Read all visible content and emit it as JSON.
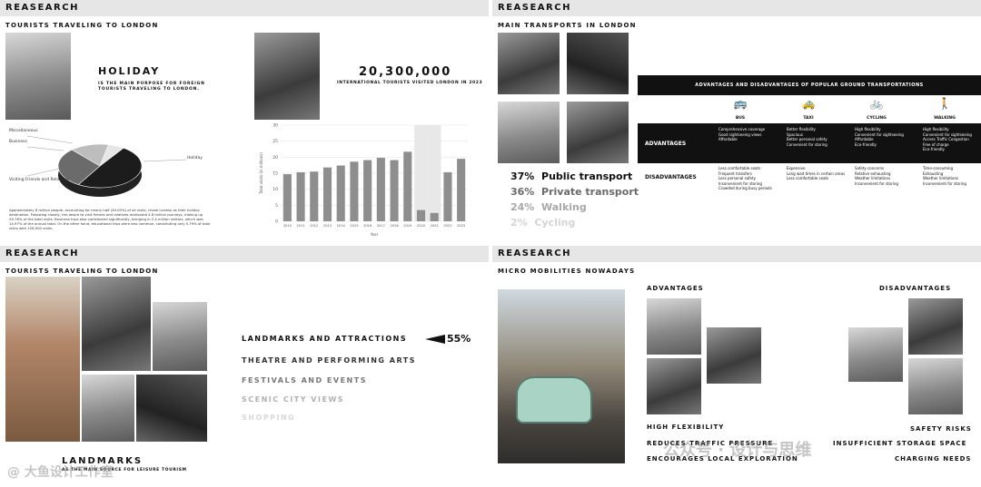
{
  "panels": {
    "p1": {
      "header": "REASEARCH",
      "subtitle": "TOURISTS TRAVELING TO LONDON",
      "holiday_title": "HOLIDAY",
      "holiday_text": "IS THE MAIN PURPOSE FOR FOREIGN TOURISTS TRAVELING TO LONDON.",
      "big_number": "20,300,000",
      "big_number_caption": "INTERNATIONAL TOURISTS VISITED LONDON IN 2023",
      "pie_labels": [
        "Miscellaneous",
        "Business",
        "Visiting Friends and Relatives",
        "Holiday"
      ],
      "paragraph": "Approximately 8 million people, accounting for nearly half (49.05%) of all visits, chose London as their holiday destination. Following closely, the desire to visit friends and relatives motivated 4.8 million journeys, making up 29.76% of the total visits. Business trips also contributed significantly, bringing in 2.4 million visitors, which was 14.97% of the annual total. On the other hand, educational trips were less common, constituting only 0.79% of total visits with 128,000 visits."
    },
    "p2": {
      "header": "REASEARCH",
      "subtitle": "MAIN TRANSPORTS IN LONDON",
      "table_title": "ADVANTAGES AND DISADVANTAGES OF POPULAR GROUND TRANSPORTATIONS",
      "modes": [
        "BUS",
        "TAXI",
        "CYCLING",
        "WALKING"
      ],
      "advantages_label": "ADVANTAGES",
      "disadvantages_label": "DISADVANTAGES",
      "adv": [
        "Comprehensive coverage\nGood sightseeing views\nAffordable",
        "Better flexibility\nSpacious\nBetter personal safety\nConvenient for storing",
        "High flexibility\nConvenient for sightseeing\nAffordable\nEco-friendly",
        "High flexibility\nConvenient for sightseeing\nAccess Traffic Congestion\nFree of charge\nEco-friendly"
      ],
      "dis": [
        "Less comfortable seats\nFrequent transfers\nLess personal safety\nInconvenient for storing\nCrowded during busy periods",
        "Expensive\nLong wait times in certain areas\nLess comfortable seats",
        "Safety concerns\nRelative exhausting\nWeather limitations\nInconvenient for storing",
        "Time-consuming\nExhausting\nWeather limitations\nInconvenient for storing"
      ],
      "shares": [
        {
          "pct": "37%",
          "label": "Public transport",
          "color": "#111111"
        },
        {
          "pct": "36%",
          "label": "Private transport",
          "color": "#6a6a6a"
        },
        {
          "pct": "24%",
          "label": "Walking",
          "color": "#a8a8a8"
        },
        {
          "pct": "2%",
          "label": "Cycling",
          "color": "#d4d4d4"
        }
      ]
    },
    "p3": {
      "header": "REASEARCH",
      "subtitle": "TOURISTS TRAVELING TO LONDON",
      "items": [
        {
          "label": "LANDMARKS AND ATTRACTIONS",
          "color": "#111111"
        },
        {
          "label": "THEATRE AND PERFORMING ARTS",
          "color": "#333333"
        },
        {
          "label": "FESTIVALS AND EVENTS",
          "color": "#777777"
        },
        {
          "label": "SCENIC CITY VIEWS",
          "color": "#b0b0b0"
        },
        {
          "label": "SHOPPING",
          "color": "#d8d8d8"
        }
      ],
      "pct": "55%",
      "bottom_title": "LANDMARKS",
      "bottom_caption": "AS THE MAIN SOURCE FOR LEISURE TOURISM"
    },
    "p4": {
      "header": "REASEARCH",
      "subtitle": "MICRO MOBILITIES NOWADAYS",
      "advantages": "ADVANTAGES",
      "disadvantages": "DISADVANTAGES",
      "adv_items": [
        "HIGH FLEXIBILITY",
        "REDUCES TRAFFIC PRESSURE",
        "ENCOURAGES LOCAL EXPLORATION"
      ],
      "dis_items": [
        "SAFETY RISKS",
        "INSUFFICIENT STORAGE SPACE",
        "CHARGING NEEDS"
      ]
    }
  },
  "chart_data": {
    "type": "bar",
    "categories": [
      "2010",
      "2011",
      "2012",
      "2013",
      "2014",
      "2015",
      "2016",
      "2017",
      "2018",
      "2019",
      "2020",
      "2021",
      "2022",
      "2023"
    ],
    "values": [
      14.7,
      15.3,
      15.5,
      16.8,
      17.4,
      18.6,
      19.1,
      19.8,
      19.1,
      21.7,
      3.5,
      2.6,
      15.3,
      19.5
    ],
    "ylabel": "Total visits (in millions)",
    "xlabel": "Year",
    "ylim": [
      0,
      30
    ],
    "yticks": [
      "0",
      "5",
      "10",
      "15",
      "20",
      "25",
      "30"
    ],
    "highlight": [
      "2020",
      "2021"
    ]
  },
  "pie_chart": {
    "type": "pie",
    "values": [
      49.05,
      29.76,
      14.97,
      6.22
    ],
    "colors": [
      "#1c1c1c",
      "#6b6b6b",
      "#bdbdbd",
      "#e6e6e6"
    ]
  },
  "watermark": {
    "left": "@ 大鱼设计工作室",
    "right": "公众号 · 设计与思维"
  }
}
